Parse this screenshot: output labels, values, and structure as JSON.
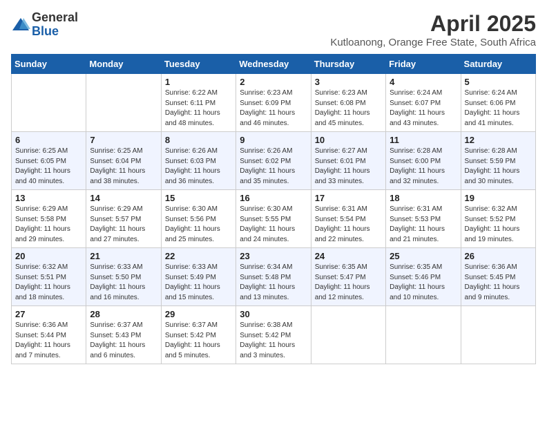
{
  "header": {
    "logo_general": "General",
    "logo_blue": "Blue",
    "month_year": "April 2025",
    "subtitle": "Kutloanong, Orange Free State, South Africa"
  },
  "weekdays": [
    "Sunday",
    "Monday",
    "Tuesday",
    "Wednesday",
    "Thursday",
    "Friday",
    "Saturday"
  ],
  "weeks": [
    [
      {
        "day": "",
        "content": ""
      },
      {
        "day": "",
        "content": ""
      },
      {
        "day": "1",
        "content": "Sunrise: 6:22 AM\nSunset: 6:11 PM\nDaylight: 11 hours and 48 minutes."
      },
      {
        "day": "2",
        "content": "Sunrise: 6:23 AM\nSunset: 6:09 PM\nDaylight: 11 hours and 46 minutes."
      },
      {
        "day": "3",
        "content": "Sunrise: 6:23 AM\nSunset: 6:08 PM\nDaylight: 11 hours and 45 minutes."
      },
      {
        "day": "4",
        "content": "Sunrise: 6:24 AM\nSunset: 6:07 PM\nDaylight: 11 hours and 43 minutes."
      },
      {
        "day": "5",
        "content": "Sunrise: 6:24 AM\nSunset: 6:06 PM\nDaylight: 11 hours and 41 minutes."
      }
    ],
    [
      {
        "day": "6",
        "content": "Sunrise: 6:25 AM\nSunset: 6:05 PM\nDaylight: 11 hours and 40 minutes."
      },
      {
        "day": "7",
        "content": "Sunrise: 6:25 AM\nSunset: 6:04 PM\nDaylight: 11 hours and 38 minutes."
      },
      {
        "day": "8",
        "content": "Sunrise: 6:26 AM\nSunset: 6:03 PM\nDaylight: 11 hours and 36 minutes."
      },
      {
        "day": "9",
        "content": "Sunrise: 6:26 AM\nSunset: 6:02 PM\nDaylight: 11 hours and 35 minutes."
      },
      {
        "day": "10",
        "content": "Sunrise: 6:27 AM\nSunset: 6:01 PM\nDaylight: 11 hours and 33 minutes."
      },
      {
        "day": "11",
        "content": "Sunrise: 6:28 AM\nSunset: 6:00 PM\nDaylight: 11 hours and 32 minutes."
      },
      {
        "day": "12",
        "content": "Sunrise: 6:28 AM\nSunset: 5:59 PM\nDaylight: 11 hours and 30 minutes."
      }
    ],
    [
      {
        "day": "13",
        "content": "Sunrise: 6:29 AM\nSunset: 5:58 PM\nDaylight: 11 hours and 29 minutes."
      },
      {
        "day": "14",
        "content": "Sunrise: 6:29 AM\nSunset: 5:57 PM\nDaylight: 11 hours and 27 minutes."
      },
      {
        "day": "15",
        "content": "Sunrise: 6:30 AM\nSunset: 5:56 PM\nDaylight: 11 hours and 25 minutes."
      },
      {
        "day": "16",
        "content": "Sunrise: 6:30 AM\nSunset: 5:55 PM\nDaylight: 11 hours and 24 minutes."
      },
      {
        "day": "17",
        "content": "Sunrise: 6:31 AM\nSunset: 5:54 PM\nDaylight: 11 hours and 22 minutes."
      },
      {
        "day": "18",
        "content": "Sunrise: 6:31 AM\nSunset: 5:53 PM\nDaylight: 11 hours and 21 minutes."
      },
      {
        "day": "19",
        "content": "Sunrise: 6:32 AM\nSunset: 5:52 PM\nDaylight: 11 hours and 19 minutes."
      }
    ],
    [
      {
        "day": "20",
        "content": "Sunrise: 6:32 AM\nSunset: 5:51 PM\nDaylight: 11 hours and 18 minutes."
      },
      {
        "day": "21",
        "content": "Sunrise: 6:33 AM\nSunset: 5:50 PM\nDaylight: 11 hours and 16 minutes."
      },
      {
        "day": "22",
        "content": "Sunrise: 6:33 AM\nSunset: 5:49 PM\nDaylight: 11 hours and 15 minutes."
      },
      {
        "day": "23",
        "content": "Sunrise: 6:34 AM\nSunset: 5:48 PM\nDaylight: 11 hours and 13 minutes."
      },
      {
        "day": "24",
        "content": "Sunrise: 6:35 AM\nSunset: 5:47 PM\nDaylight: 11 hours and 12 minutes."
      },
      {
        "day": "25",
        "content": "Sunrise: 6:35 AM\nSunset: 5:46 PM\nDaylight: 11 hours and 10 minutes."
      },
      {
        "day": "26",
        "content": "Sunrise: 6:36 AM\nSunset: 5:45 PM\nDaylight: 11 hours and 9 minutes."
      }
    ],
    [
      {
        "day": "27",
        "content": "Sunrise: 6:36 AM\nSunset: 5:44 PM\nDaylight: 11 hours and 7 minutes."
      },
      {
        "day": "28",
        "content": "Sunrise: 6:37 AM\nSunset: 5:43 PM\nDaylight: 11 hours and 6 minutes."
      },
      {
        "day": "29",
        "content": "Sunrise: 6:37 AM\nSunset: 5:42 PM\nDaylight: 11 hours and 5 minutes."
      },
      {
        "day": "30",
        "content": "Sunrise: 6:38 AM\nSunset: 5:42 PM\nDaylight: 11 hours and 3 minutes."
      },
      {
        "day": "",
        "content": ""
      },
      {
        "day": "",
        "content": ""
      },
      {
        "day": "",
        "content": ""
      }
    ]
  ]
}
